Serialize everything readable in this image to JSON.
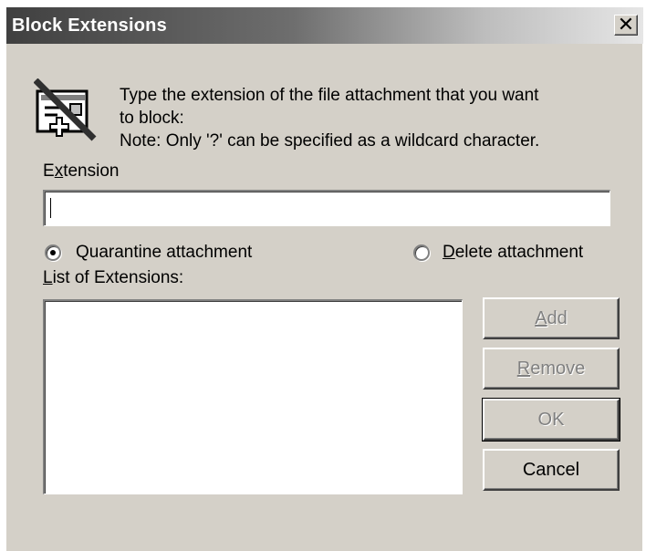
{
  "window": {
    "title": "Block Extensions",
    "close_glyph": "✕"
  },
  "message": {
    "icon": "blocked-attachment-icon",
    "line1": "Type the extension of the file attachment that you want",
    "line2": "to block:",
    "line3": "Note: Only '?' can be specified as a wildcard character."
  },
  "extension_field": {
    "label_pre": "E",
    "label_u": "x",
    "label_post": "tension",
    "value": ""
  },
  "radios": {
    "quarantine": {
      "label": "Quarantine attachment",
      "selected": true
    },
    "delete": {
      "label_u": "D",
      "label_rest": "elete attachment",
      "selected": false
    }
  },
  "list": {
    "label_u": "L",
    "label_rest": "ist of Extensions:",
    "items": []
  },
  "buttons": {
    "add": {
      "label_u": "A",
      "label_rest": "dd",
      "enabled": false
    },
    "remove": {
      "label_u": "R",
      "label_rest": "emove",
      "enabled": false
    },
    "ok": {
      "label": "OK",
      "enabled": false
    },
    "cancel": {
      "label": "Cancel",
      "enabled": true
    }
  }
}
